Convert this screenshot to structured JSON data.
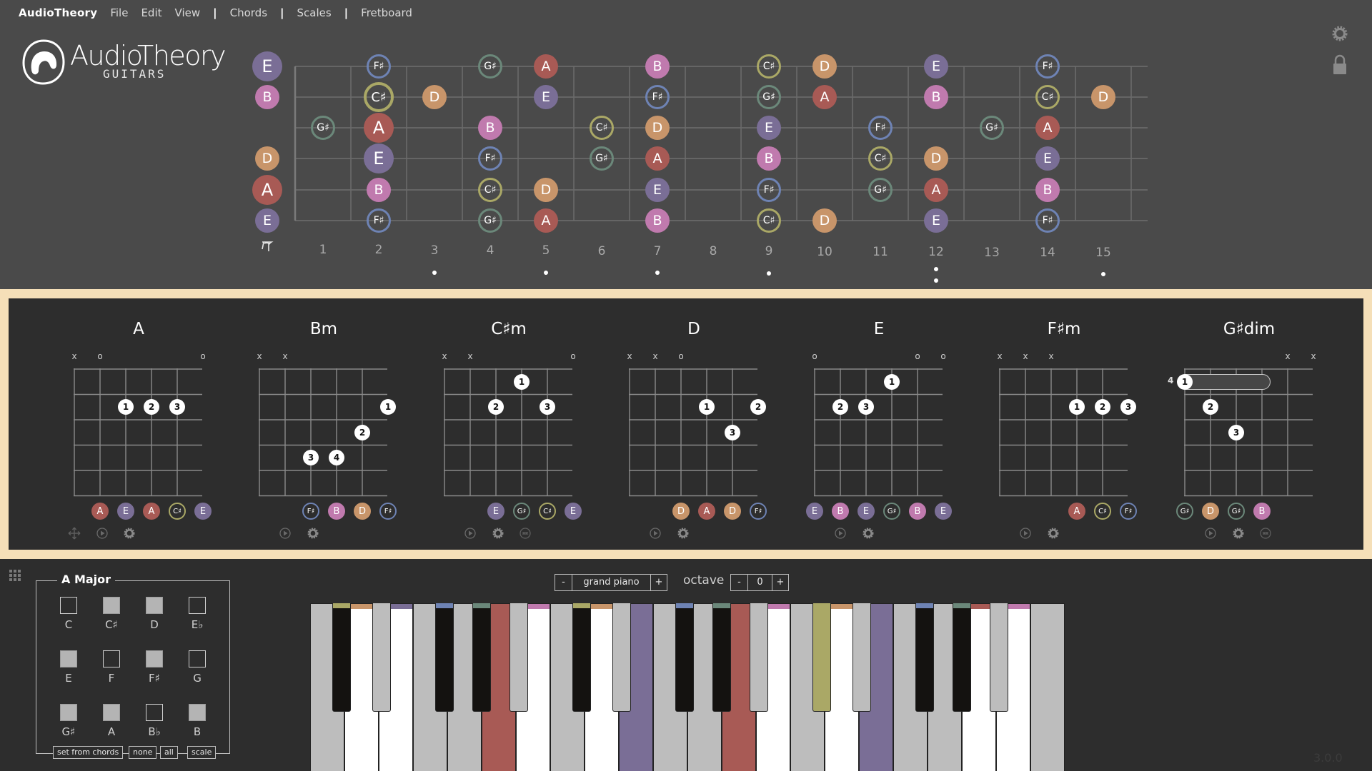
{
  "menu": {
    "brand": "AudioTheory",
    "items": [
      "File",
      "Edit",
      "View"
    ],
    "separator": "|",
    "sections": [
      "Chords",
      "Scales",
      "Fretboard"
    ]
  },
  "logo": {
    "word": "AudioTheory",
    "sub": "GUITARS"
  },
  "colors": {
    "A": "#a85a55",
    "B": "#c07aae",
    "C#": "#aaa866",
    "D": "#c8956a",
    "E": "#7a6e96",
    "F#": "#6e83b4",
    "G#": "#6b887a",
    "accent_border": "#f5dfb8"
  },
  "ring_notes": [
    "C#",
    "F#",
    "G#"
  ],
  "fretboard": {
    "open_strings": [
      "E",
      "B",
      "",
      "D",
      "A",
      "E"
    ],
    "open_big": [
      true,
      false,
      false,
      false,
      true,
      false
    ],
    "fret_numbers": [
      "1",
      "2",
      "3",
      "4",
      "5",
      "6",
      "7",
      "8",
      "9",
      "10",
      "11",
      "12",
      "13",
      "14",
      "15"
    ],
    "inlay_frets": [
      3,
      5,
      7,
      9,
      12,
      15
    ],
    "double_inlay_frets": [
      12
    ],
    "nut_label": "open",
    "notes": [
      {
        "s": 0,
        "f": 2,
        "n": "F#"
      },
      {
        "s": 0,
        "f": 4,
        "n": "G#"
      },
      {
        "s": 0,
        "f": 5,
        "n": "A"
      },
      {
        "s": 0,
        "f": 7,
        "n": "B"
      },
      {
        "s": 0,
        "f": 9,
        "n": "C#"
      },
      {
        "s": 0,
        "f": 10,
        "n": "D"
      },
      {
        "s": 0,
        "f": 12,
        "n": "E"
      },
      {
        "s": 0,
        "f": 14,
        "n": "F#"
      },
      {
        "s": 1,
        "f": 2,
        "n": "C#",
        "big": true
      },
      {
        "s": 1,
        "f": 3,
        "n": "D"
      },
      {
        "s": 1,
        "f": 5,
        "n": "E"
      },
      {
        "s": 1,
        "f": 7,
        "n": "F#"
      },
      {
        "s": 1,
        "f": 9,
        "n": "G#"
      },
      {
        "s": 1,
        "f": 10,
        "n": "A"
      },
      {
        "s": 1,
        "f": 12,
        "n": "B"
      },
      {
        "s": 1,
        "f": 14,
        "n": "C#"
      },
      {
        "s": 1,
        "f": 15,
        "n": "D"
      },
      {
        "s": 2,
        "f": 1,
        "n": "G#"
      },
      {
        "s": 2,
        "f": 2,
        "n": "A",
        "big": true
      },
      {
        "s": 2,
        "f": 4,
        "n": "B"
      },
      {
        "s": 2,
        "f": 6,
        "n": "C#"
      },
      {
        "s": 2,
        "f": 7,
        "n": "D"
      },
      {
        "s": 2,
        "f": 9,
        "n": "E"
      },
      {
        "s": 2,
        "f": 11,
        "n": "F#"
      },
      {
        "s": 2,
        "f": 13,
        "n": "G#"
      },
      {
        "s": 2,
        "f": 14,
        "n": "A"
      },
      {
        "s": 3,
        "f": 2,
        "n": "E",
        "big": true
      },
      {
        "s": 3,
        "f": 4,
        "n": "F#"
      },
      {
        "s": 3,
        "f": 6,
        "n": "G#"
      },
      {
        "s": 3,
        "f": 7,
        "n": "A"
      },
      {
        "s": 3,
        "f": 9,
        "n": "B"
      },
      {
        "s": 3,
        "f": 11,
        "n": "C#"
      },
      {
        "s": 3,
        "f": 12,
        "n": "D"
      },
      {
        "s": 3,
        "f": 14,
        "n": "E"
      },
      {
        "s": 4,
        "f": 2,
        "n": "B"
      },
      {
        "s": 4,
        "f": 4,
        "n": "C#"
      },
      {
        "s": 4,
        "f": 5,
        "n": "D"
      },
      {
        "s": 4,
        "f": 7,
        "n": "E"
      },
      {
        "s": 4,
        "f": 9,
        "n": "F#"
      },
      {
        "s": 4,
        "f": 11,
        "n": "G#"
      },
      {
        "s": 4,
        "f": 12,
        "n": "A"
      },
      {
        "s": 4,
        "f": 14,
        "n": "B"
      },
      {
        "s": 5,
        "f": 2,
        "n": "F#"
      },
      {
        "s": 5,
        "f": 4,
        "n": "G#"
      },
      {
        "s": 5,
        "f": 5,
        "n": "A"
      },
      {
        "s": 5,
        "f": 7,
        "n": "B"
      },
      {
        "s": 5,
        "f": 9,
        "n": "C#"
      },
      {
        "s": 5,
        "f": 10,
        "n": "D"
      },
      {
        "s": 5,
        "f": 12,
        "n": "E"
      },
      {
        "s": 5,
        "f": 14,
        "n": "F#"
      }
    ]
  },
  "chords": [
    {
      "name": "A",
      "marks": [
        "x",
        "o",
        "",
        "",
        "",
        "o"
      ],
      "fingers": [
        {
          "s": 2,
          "f": 2,
          "n": "1"
        },
        {
          "s": 3,
          "f": 2,
          "n": "2"
        },
        {
          "s": 4,
          "f": 2,
          "n": "3"
        }
      ],
      "notes": [
        "",
        "A",
        "E",
        "A",
        "C#",
        "E"
      ],
      "controls": [
        "move",
        "play",
        "settings"
      ]
    },
    {
      "name": "Bm",
      "marks": [
        "x",
        "x",
        "",
        "",
        "",
        ""
      ],
      "fingers": [
        {
          "s": 5,
          "f": 2,
          "n": "1"
        },
        {
          "s": 4,
          "f": 3,
          "n": "2"
        },
        {
          "s": 2,
          "f": 4,
          "n": "3"
        },
        {
          "s": 3,
          "f": 4,
          "n": "4"
        }
      ],
      "notes": [
        "",
        "",
        "F#",
        "B",
        "D",
        "F#"
      ],
      "controls": [
        "play",
        "settings"
      ]
    },
    {
      "name": "C♯m",
      "marks": [
        "x",
        "x",
        "",
        "",
        "",
        "o"
      ],
      "fingers": [
        {
          "s": 3,
          "f": 1,
          "n": "1"
        },
        {
          "s": 2,
          "f": 2,
          "n": "2"
        },
        {
          "s": 4,
          "f": 2,
          "n": "3"
        }
      ],
      "notes": [
        "",
        "",
        "E",
        "G#",
        "C#",
        "E"
      ],
      "controls": [
        "play",
        "settings",
        "swap"
      ]
    },
    {
      "name": "D",
      "marks": [
        "x",
        "x",
        "o",
        "",
        "",
        ""
      ],
      "fingers": [
        {
          "s": 3,
          "f": 2,
          "n": "1"
        },
        {
          "s": 5,
          "f": 2,
          "n": "2"
        },
        {
          "s": 4,
          "f": 3,
          "n": "3"
        }
      ],
      "notes": [
        "",
        "",
        "D",
        "A",
        "D",
        "F#"
      ],
      "controls": [
        "play",
        "settings"
      ]
    },
    {
      "name": "E",
      "marks": [
        "o",
        "",
        "",
        "",
        "o",
        "o"
      ],
      "fingers": [
        {
          "s": 3,
          "f": 1,
          "n": "1"
        },
        {
          "s": 1,
          "f": 2,
          "n": "2"
        },
        {
          "s": 2,
          "f": 2,
          "n": "3"
        }
      ],
      "notes": [
        "E",
        "B",
        "E",
        "G#",
        "B",
        "E"
      ],
      "controls": [
        "play",
        "settings"
      ]
    },
    {
      "name": "F♯m",
      "marks": [
        "x",
        "x",
        "x",
        "",
        "",
        ""
      ],
      "fingers": [
        {
          "s": 3,
          "f": 2,
          "n": "1"
        },
        {
          "s": 4,
          "f": 2,
          "n": "2"
        },
        {
          "s": 5,
          "f": 2,
          "n": "3"
        }
      ],
      "notes": [
        "",
        "",
        "",
        "A",
        "C#",
        "F#"
      ],
      "controls": [
        "play",
        "settings"
      ]
    },
    {
      "name": "G♯dim",
      "marks": [
        "",
        "",
        "",
        "",
        "x",
        "x"
      ],
      "start_fret": "4",
      "barre": {
        "f": 1,
        "from": 0,
        "to": 3
      },
      "fingers": [
        {
          "s": 0,
          "f": 1,
          "n": "1"
        },
        {
          "s": 1,
          "f": 2,
          "n": "2"
        },
        {
          "s": 2,
          "f": 3,
          "n": "3"
        }
      ],
      "notes": [
        "G#",
        "D",
        "G#",
        "B",
        "",
        ""
      ],
      "controls": [
        "play",
        "settings",
        "swap"
      ]
    }
  ],
  "scale": {
    "title": "A Major",
    "pitch_classes": [
      {
        "label": "C",
        "on": false
      },
      {
        "label": "C♯",
        "on": true
      },
      {
        "label": "D",
        "on": true
      },
      {
        "label": "E♭",
        "on": false
      },
      {
        "label": "E",
        "on": true
      },
      {
        "label": "F",
        "on": false
      },
      {
        "label": "F♯",
        "on": true
      },
      {
        "label": "G",
        "on": false
      },
      {
        "label": "G♯",
        "on": true
      },
      {
        "label": "A",
        "on": true
      },
      {
        "label": "B♭",
        "on": false
      },
      {
        "label": "B",
        "on": true
      }
    ],
    "buttons": [
      "set from chords",
      "none",
      "all",
      "scale"
    ]
  },
  "instrument": {
    "minus": "-",
    "name": "grand piano",
    "plus": "+"
  },
  "octave": {
    "label": "octave",
    "minus": "-",
    "value": "0",
    "plus": "+"
  },
  "piano": {
    "start_note": "C",
    "highlighted": [
      "A",
      "E",
      "A",
      "C#",
      "E"
    ],
    "white_keys": [
      {
        "n": "C",
        "state": "off"
      },
      {
        "n": "D",
        "state": "scale"
      },
      {
        "n": "E",
        "state": "scale"
      },
      {
        "n": "F",
        "state": "off"
      },
      {
        "n": "G",
        "state": "off"
      },
      {
        "n": "A",
        "state": "hl"
      },
      {
        "n": "B",
        "state": "scale"
      },
      {
        "n": "C",
        "state": "off"
      },
      {
        "n": "D",
        "state": "scale"
      },
      {
        "n": "E",
        "state": "hl"
      },
      {
        "n": "F",
        "state": "off"
      },
      {
        "n": "G",
        "state": "off"
      },
      {
        "n": "A",
        "state": "hl"
      },
      {
        "n": "B",
        "state": "scale"
      },
      {
        "n": "C",
        "state": "off"
      },
      {
        "n": "D",
        "state": "scale"
      },
      {
        "n": "E",
        "state": "hl"
      },
      {
        "n": "F",
        "state": "off"
      },
      {
        "n": "G",
        "state": "off"
      },
      {
        "n": "A",
        "state": "scale"
      },
      {
        "n": "B",
        "state": "scale"
      },
      {
        "n": "C",
        "state": "off"
      }
    ],
    "black_keys": [
      {
        "after": 0,
        "n": "C#",
        "state": "scale"
      },
      {
        "after": 1,
        "n": "D#",
        "state": "off"
      },
      {
        "after": 3,
        "n": "F#",
        "state": "scale"
      },
      {
        "after": 4,
        "n": "G#",
        "state": "scale"
      },
      {
        "after": 5,
        "n": "A#",
        "state": "off"
      },
      {
        "after": 7,
        "n": "C#",
        "state": "scale"
      },
      {
        "after": 8,
        "n": "D#",
        "state": "off"
      },
      {
        "after": 10,
        "n": "F#",
        "state": "scale"
      },
      {
        "after": 11,
        "n": "G#",
        "state": "scale"
      },
      {
        "after": 12,
        "n": "A#",
        "state": "off"
      },
      {
        "after": 14,
        "n": "C#",
        "state": "hl"
      },
      {
        "after": 15,
        "n": "D#",
        "state": "off"
      },
      {
        "after": 17,
        "n": "F#",
        "state": "scale"
      },
      {
        "after": 18,
        "n": "G#",
        "state": "scale"
      },
      {
        "after": 19,
        "n": "A#",
        "state": "off"
      }
    ]
  },
  "version": "3.0.0"
}
